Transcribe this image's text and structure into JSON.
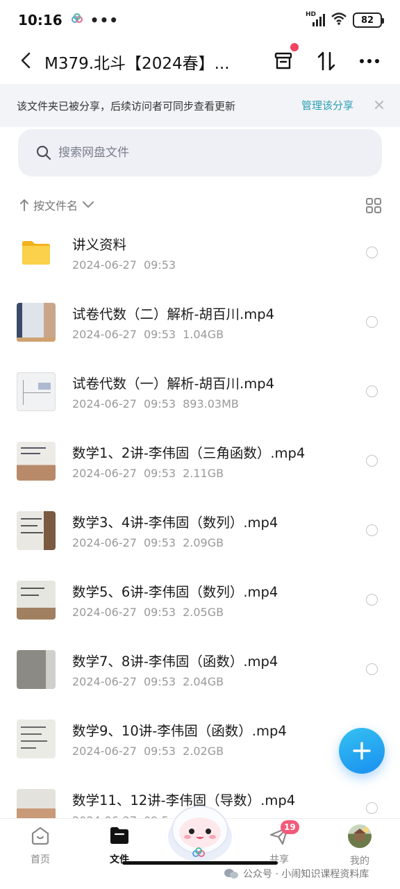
{
  "status_bar": {
    "time": "10:16",
    "dots": "•••",
    "hd": "HD",
    "battery": "82"
  },
  "header": {
    "title": "M379.北斗【2024春】..."
  },
  "share_banner": {
    "text": "该文件夹已被分享，后续访问者可同步查看更新",
    "manage_label": "管理该分享"
  },
  "search": {
    "placeholder": "搜索网盘文件"
  },
  "sort": {
    "label": "按文件名"
  },
  "files": [
    {
      "name": "讲义资料",
      "date": "2024-06-27",
      "time": "09:53",
      "size": "",
      "kind": "folder"
    },
    {
      "name": "试卷代数（二）解析-胡百川.mp4",
      "date": "2024-06-27",
      "time": "09:53",
      "size": "1.04GB",
      "kind": "video"
    },
    {
      "name": "试卷代数（一）解析-胡百川.mp4",
      "date": "2024-06-27",
      "time": "09:53",
      "size": "893.03MB",
      "kind": "video"
    },
    {
      "name": "数学1、2讲-李伟固（三角函数）.mp4",
      "date": "2024-06-27",
      "time": "09:53",
      "size": "2.11GB",
      "kind": "video"
    },
    {
      "name": "数学3、4讲-李伟固（数列）.mp4",
      "date": "2024-06-27",
      "time": "09:53",
      "size": "2.09GB",
      "kind": "video"
    },
    {
      "name": "数学5、6讲-李伟固（数列）.mp4",
      "date": "2024-06-27",
      "time": "09:53",
      "size": "2.05GB",
      "kind": "video"
    },
    {
      "name": "数学7、8讲-李伟固（函数）.mp4",
      "date": "2024-06-27",
      "time": "09:53",
      "size": "2.04GB",
      "kind": "video"
    },
    {
      "name": "数学9、10讲-李伟固（函数）.mp4",
      "date": "2024-06-27",
      "time": "09:53",
      "size": "2.02GB",
      "kind": "video"
    },
    {
      "name": "数学11、12讲-李伟固（导数）.mp4",
      "date": "2024-06-27",
      "time": "09:5",
      "size": "",
      "kind": "video"
    }
  ],
  "nav": {
    "home": "首页",
    "files": "文件",
    "share": "共享",
    "share_badge": "19",
    "me": "我的"
  },
  "watermark": "公众号 · 小闹知识课程资料库",
  "colors": {
    "accent": "#29a0b4",
    "fab": "#1a8ff0",
    "badge": "#f25a7a",
    "folder": "#f7c531"
  }
}
